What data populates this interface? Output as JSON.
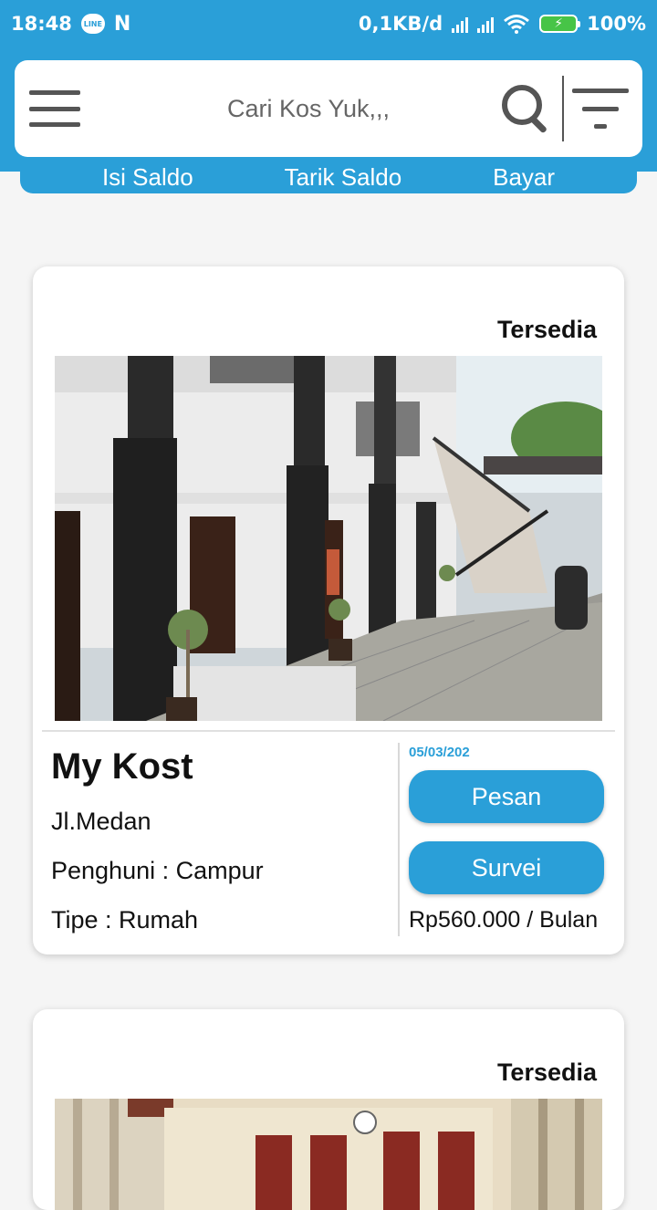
{
  "status_bar": {
    "time": "18:48",
    "line_label": "LINE",
    "network_speed": "0,1KB/d",
    "battery": "100%"
  },
  "header": {
    "search_placeholder": "Cari Kos Yuk,,,",
    "saldo_actions": [
      "Isi Saldo",
      "Tarik Saldo",
      "Bayar"
    ]
  },
  "listings": [
    {
      "status": "Tersedia",
      "name": "My Kost",
      "address": "Jl.Medan",
      "occupant": "Penghuni : Campur",
      "type": "Tipe : Rumah",
      "date": "05/03/202",
      "order_label": "Pesan",
      "survey_label": "Survei",
      "price": "Rp560.000 / Bulan"
    },
    {
      "status": "Tersedia"
    }
  ],
  "colors": {
    "primary": "#2a9fd8",
    "background": "#f5f5f5",
    "card": "#ffffff"
  }
}
